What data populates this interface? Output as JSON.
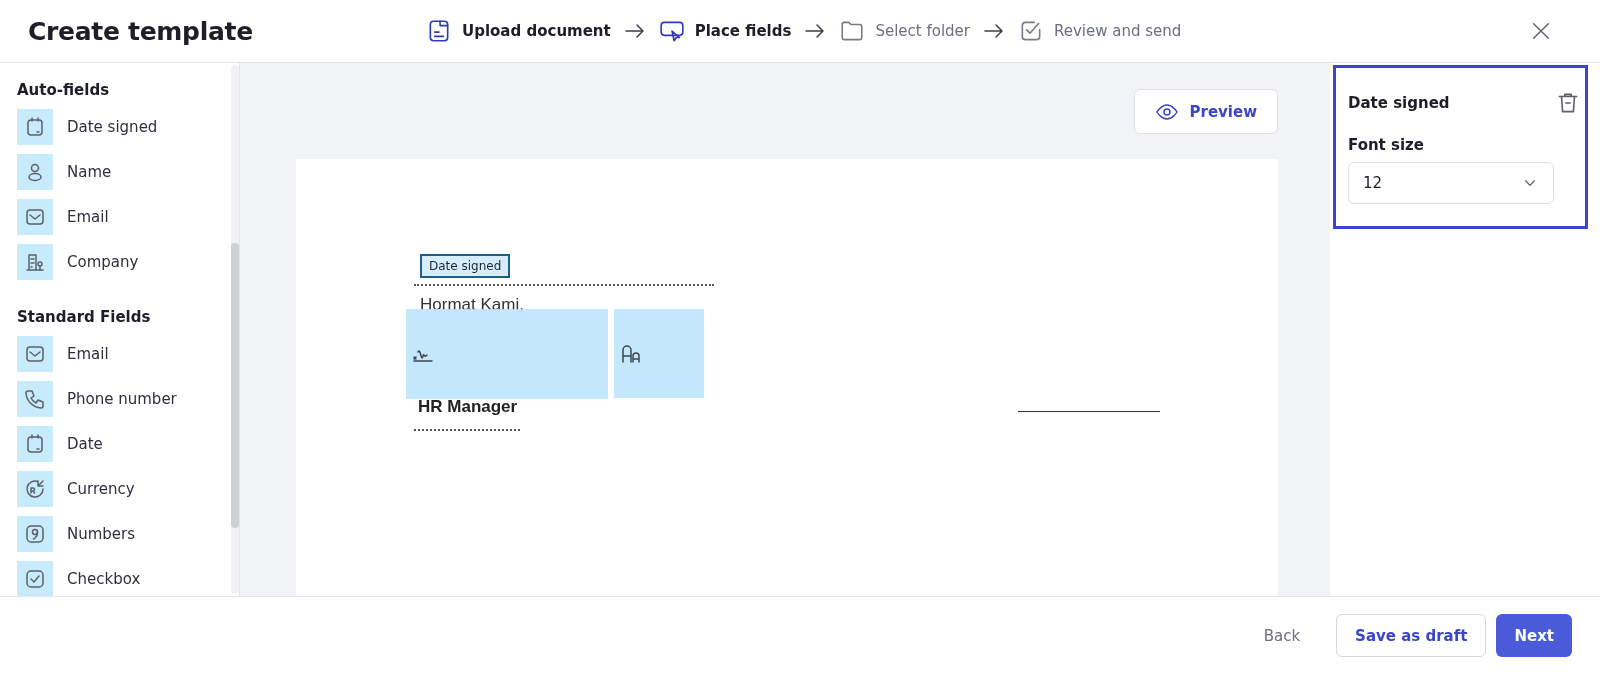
{
  "header": {
    "title": "Create template",
    "steps": [
      {
        "label": "Upload document",
        "active": true
      },
      {
        "label": "Place fields",
        "active": true
      },
      {
        "label": "Select folder",
        "active": false
      },
      {
        "label": "Review and send",
        "active": false
      }
    ]
  },
  "sidebar": {
    "sections": [
      {
        "title": "Auto-fields",
        "items": [
          {
            "label": "Date signed"
          },
          {
            "label": "Name"
          },
          {
            "label": "Email"
          },
          {
            "label": "Company"
          }
        ]
      },
      {
        "title": "Standard Fields",
        "items": [
          {
            "label": "Email"
          },
          {
            "label": "Phone number"
          },
          {
            "label": "Date"
          },
          {
            "label": "Currency"
          },
          {
            "label": "Numbers"
          },
          {
            "label": "Checkbox"
          }
        ]
      }
    ]
  },
  "preview_button": {
    "label": "Preview"
  },
  "document": {
    "lines": [
      {
        "text": "Hormat Kami,"
      },
      {
        "text": "HR Manager"
      }
    ],
    "fields": [
      {
        "kind": "label",
        "text": "Date signed",
        "selected": true
      },
      {
        "kind": "signature"
      },
      {
        "kind": "text"
      }
    ]
  },
  "properties": {
    "title": "Date signed",
    "font_size": {
      "label": "Font size",
      "value": "12"
    }
  },
  "footer": {
    "back": "Back",
    "draft": "Save as draft",
    "next": "Next"
  }
}
